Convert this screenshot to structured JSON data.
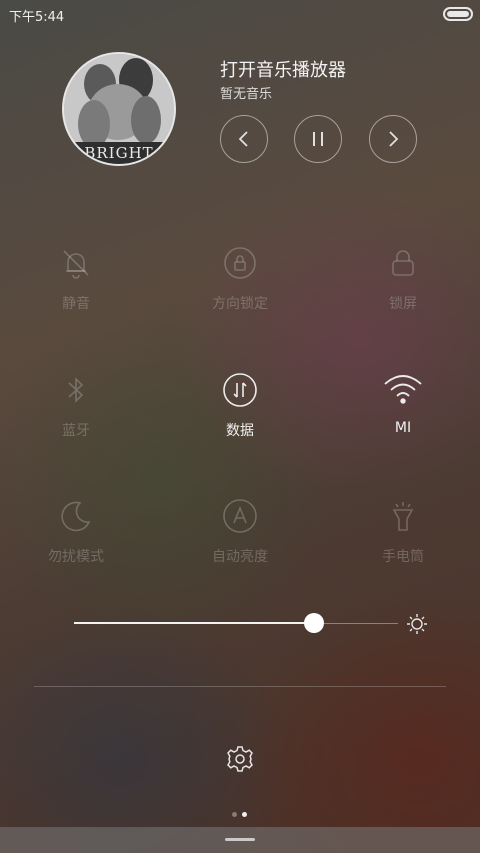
{
  "status_bar": {
    "time": "下午5:44"
  },
  "music": {
    "title": "打开音乐播放器",
    "subtitle": "暂无音乐",
    "album_text": "BRIGHT"
  },
  "toggles": [
    {
      "label": "静音",
      "icon": "bell-off-icon",
      "state": "off"
    },
    {
      "label": "方向锁定",
      "icon": "rotation-lock-icon",
      "state": "off"
    },
    {
      "label": "锁屏",
      "icon": "lock-icon",
      "state": "off"
    },
    {
      "label": "蓝牙",
      "icon": "bluetooth-icon",
      "state": "off"
    },
    {
      "label": "数据",
      "icon": "data-icon",
      "state": "on"
    },
    {
      "label": "MI",
      "icon": "wifi-icon",
      "state": "on"
    },
    {
      "label": "勿扰模式",
      "icon": "moon-icon",
      "state": "off"
    },
    {
      "label": "自动亮度",
      "icon": "auto-brightness-icon",
      "state": "off"
    },
    {
      "label": "手电筒",
      "icon": "flashlight-icon",
      "state": "off"
    }
  ],
  "brightness": {
    "level_percent": 74
  },
  "pager": {
    "pages": 2,
    "current": 2
  },
  "colors": {
    "active": "#f0f0f0",
    "inactive": "rgba(200,200,200,0.32)"
  }
}
